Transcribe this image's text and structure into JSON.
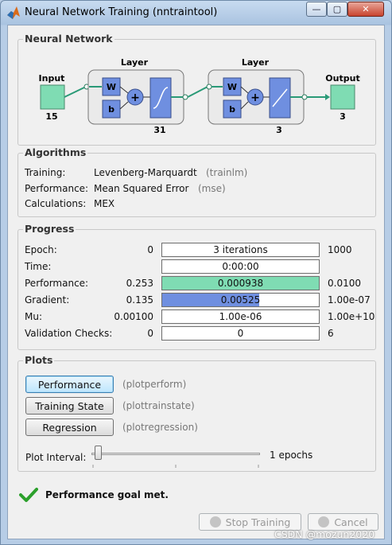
{
  "window": {
    "title": "Neural Network Training (nntraintool)",
    "minimize": "—",
    "maximize": "▢",
    "close": "✕"
  },
  "network": {
    "section_title": "Neural Network",
    "input_label": "Input",
    "input_size": "15",
    "layer1_label": "Layer",
    "layer1_size": "31",
    "layer2_label": "Layer",
    "layer2_size": "3",
    "output_label": "Output",
    "output_size": "3",
    "weight_label": "W",
    "bias_label": "b",
    "sum_symbol": "+",
    "colors": {
      "io_box": "#7fdcb3",
      "weight_box": "#6f8fe0",
      "layer_bg": "#eaeaea"
    }
  },
  "algorithms": {
    "section_title": "Algorithms",
    "rows": [
      {
        "label": "Training:",
        "value": "Levenberg-Marquardt",
        "note": "(trainlm)"
      },
      {
        "label": "Performance:",
        "value": "Mean Squared Error",
        "note": "(mse)"
      },
      {
        "label": "Calculations:",
        "value": "MEX",
        "note": ""
      }
    ]
  },
  "progress": {
    "section_title": "Progress",
    "rows": [
      {
        "label": "Epoch:",
        "start": "0",
        "current": "3 iterations",
        "end": "1000",
        "fill": 0,
        "color": ""
      },
      {
        "label": "Time:",
        "start": "",
        "current": "0:00:00",
        "end": "",
        "fill": 0,
        "color": ""
      },
      {
        "label": "Performance:",
        "start": "0.253",
        "current": "0.000938",
        "end": "0.0100",
        "fill": 1.0,
        "color": "#7fdcb3"
      },
      {
        "label": "Gradient:",
        "start": "0.135",
        "current": "0.00525",
        "end": "1.00e-07",
        "fill": 0.62,
        "color": "#6f8fe0"
      },
      {
        "label": "Mu:",
        "start": "0.00100",
        "current": "1.00e-06",
        "end": "1.00e+10",
        "fill": 0,
        "color": ""
      },
      {
        "label": "Validation Checks:",
        "start": "0",
        "current": "0",
        "end": "6",
        "fill": 0,
        "color": ""
      }
    ]
  },
  "plots": {
    "section_title": "Plots",
    "buttons": [
      {
        "label": "Performance",
        "note": "(plotperform)"
      },
      {
        "label": "Training State",
        "note": "(plottrainstate)"
      },
      {
        "label": "Regression",
        "note": "(plotregression)"
      }
    ],
    "interval_label": "Plot Interval:",
    "interval_value": "1 epochs",
    "slider_position": 0
  },
  "status": {
    "message": "Performance goal met.",
    "icon": "checkmark-icon",
    "color": "#2ca02c"
  },
  "footer": {
    "stop_label": "Stop Training",
    "cancel_label": "Cancel",
    "watermark": "CSDN @mozun2020"
  }
}
